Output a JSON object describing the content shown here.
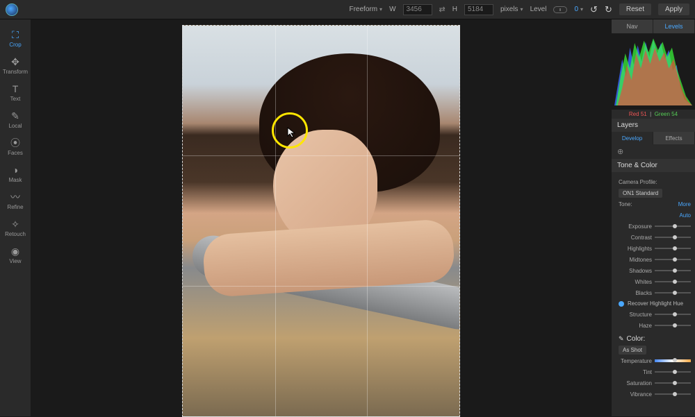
{
  "topbar": {
    "aspect_mode": "Freeform",
    "w_label": "W",
    "width": "3456",
    "h_label": "H",
    "height": "5184",
    "units": "pixels",
    "level_label": "Level",
    "angle": "0",
    "reset": "Reset",
    "apply": "Apply"
  },
  "tools": [
    {
      "name": "crop",
      "label": "Crop",
      "glyph": "⛶",
      "active": true
    },
    {
      "name": "transform",
      "label": "Transform",
      "glyph": "✥",
      "active": false
    },
    {
      "name": "text",
      "label": "Text",
      "glyph": "T",
      "active": false
    },
    {
      "name": "local",
      "label": "Local",
      "glyph": "✎",
      "active": false
    },
    {
      "name": "faces",
      "label": "Faces",
      "glyph": "⦿",
      "active": false
    },
    {
      "name": "mask",
      "label": "Mask",
      "glyph": "◑",
      "active": false
    },
    {
      "name": "refine",
      "label": "Refine",
      "glyph": "〰",
      "active": false
    },
    {
      "name": "retouch",
      "label": "Retouch",
      "glyph": "✧",
      "active": false
    },
    {
      "name": "view",
      "label": "View",
      "glyph": "◉",
      "active": false
    }
  ],
  "right": {
    "nav_tab": "Nav",
    "levels_tab": "Levels",
    "readout": {
      "red_label": "Red",
      "red": "51",
      "green_label": "Green",
      "green": "54"
    },
    "layers_title": "Layers",
    "subtabs": {
      "develop": "Develop",
      "effects": "Effects"
    },
    "tone_color_title": "Tone & Color",
    "camera_profile_label": "Camera Profile:",
    "camera_profile_value": "ON1 Standard",
    "tone_label": "Tone:",
    "tone_more": "More",
    "auto": "Auto",
    "sliders": {
      "exposure": "Exposure",
      "contrast": "Contrast",
      "highlights": "Highlights",
      "midtones": "Midtones",
      "shadows": "Shadows",
      "whites": "Whites",
      "blacks": "Blacks"
    },
    "recover": "Recover Highlight Hue",
    "structure": "Structure",
    "haze": "Haze",
    "color_title": "Color:",
    "as_shot": "As Shot",
    "temperature": "Temperature",
    "tint": "Tint",
    "saturation": "Saturation",
    "vibrance": "Vibrance"
  }
}
